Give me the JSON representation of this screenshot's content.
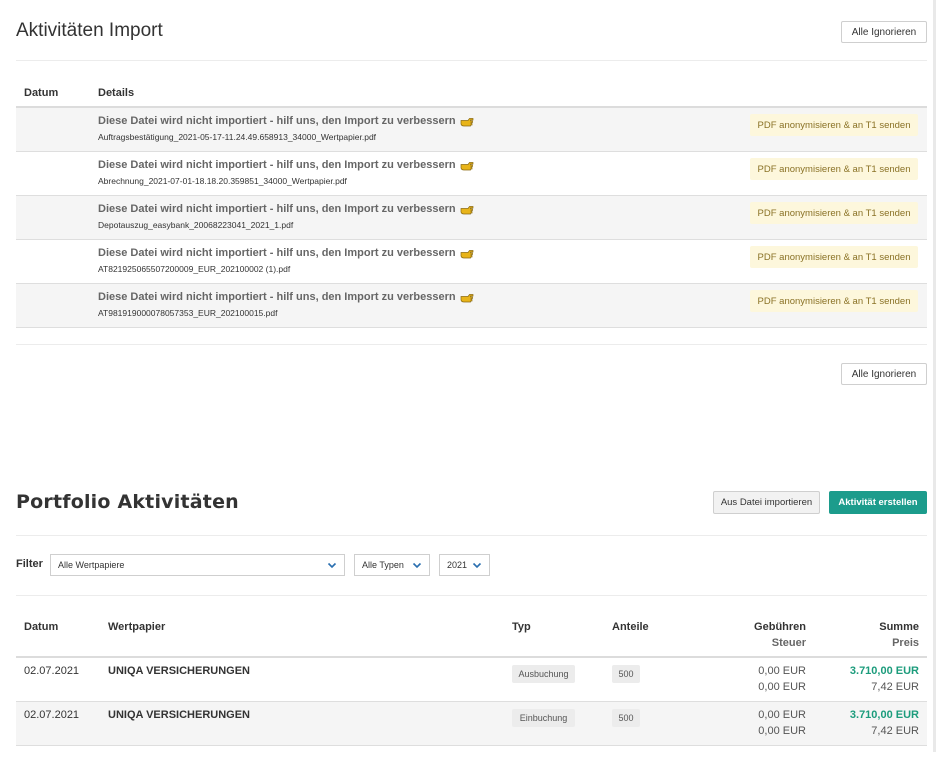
{
  "import": {
    "title": "Aktivitäten Import",
    "ignore_all_label": "Alle Ignorieren",
    "columns": {
      "datum": "Datum",
      "details": "Details"
    },
    "message": "Diese Datei wird nicht importiert - hilf uns, den Import zu verbessern",
    "send_button_label": "PDF anonymisieren & an T1 senden",
    "rows": [
      {
        "file": "Auftragsbestätigung_2021-05-17-11.24.49.658913_34000_Wertpapier.pdf"
      },
      {
        "file": "Abrechnung_2021-07-01-18.18.20.359851_34000_Wertpapier.pdf"
      },
      {
        "file": "Depotauszug_easybank_20068223041_2021_1.pdf"
      },
      {
        "file": "AT821925065507200009_EUR_202100002 (1).pdf"
      },
      {
        "file": "AT981919000078057353_EUR_202100015.pdf"
      }
    ]
  },
  "portfolio": {
    "title": "Portfolio Aktivitäten",
    "import_from_file_label": "Aus Datei importieren",
    "create_activity_label": "Aktivität erstellen",
    "filter_label": "Filter",
    "filters": {
      "securities": "Alle Wertpapiere",
      "types": "Alle Typen",
      "year": "2021"
    },
    "columns": {
      "datum": "Datum",
      "wertpapier": "Wertpapier",
      "typ": "Typ",
      "anteile": "Anteile",
      "gebuehren": "Gebühren",
      "steuer": "Steuer",
      "summe": "Summe",
      "preis": "Preis"
    },
    "rows": [
      {
        "date": "02.07.2021",
        "security": "UNIQA VERSICHERUNGEN",
        "type": "Ausbuchung",
        "shares": "500",
        "fees": "0,00 EUR",
        "tax": "0,00 EUR",
        "sum": "3.710,00 EUR",
        "price": "7,42 EUR"
      },
      {
        "date": "02.07.2021",
        "security": "UNIQA VERSICHERUNGEN",
        "type": "Einbuchung",
        "shares": "500",
        "fees": "0,00 EUR",
        "tax": "0,00 EUR",
        "sum": "3.710,00 EUR",
        "price": "7,42 EUR"
      }
    ]
  },
  "colors": {
    "accent_green": "#1c9c8c",
    "sum_green": "#1c9c7c",
    "pdf_button_bg": "#fdf7dc",
    "hand_icon": "#e8b419"
  }
}
